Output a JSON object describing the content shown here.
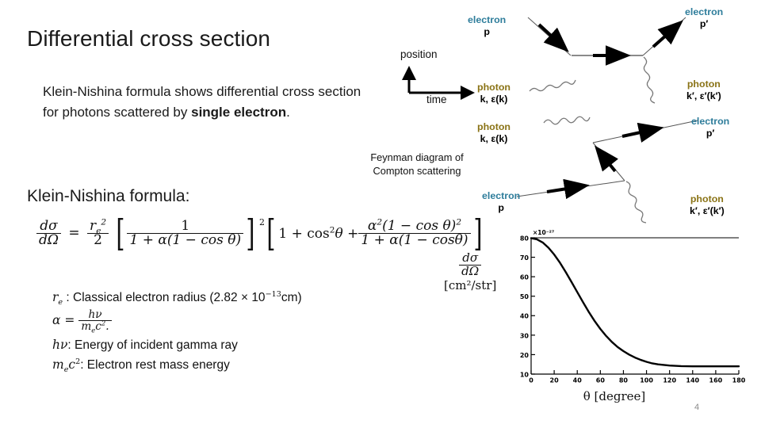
{
  "slide": {
    "title": "Differential cross section",
    "bullet_plain_1": "Klein-Nishina formula shows differential cross section for photons scattered by ",
    "bullet_bold": "single electron",
    "bullet_plain_2": ".",
    "formula_heading": "Klein-Nishina formula:",
    "page_number": "4"
  },
  "formula": {
    "lhs_num": "dσ",
    "lhs_den": "dΩ",
    "equals": "=",
    "coef_num": "r",
    "coef_num_sub": "e",
    "coef_num_sup": "2",
    "coef_den": "2",
    "bracket1_num": "1",
    "bracket1_den": "1 + α(1 − cos θ)",
    "bracket1_exp": "2",
    "bracket2_lead": "1 + cos",
    "bracket2_lead_sup": "2",
    "bracket2_theta": "θ +",
    "bracket2_num_a": "α",
    "bracket2_num_a_sup": "2",
    "bracket2_num_rest": "(1 − cos θ)",
    "bracket2_num_sup": "2",
    "bracket2_den": "1 + α(1 − cosθ)"
  },
  "definitions": {
    "re_sym": "r",
    "re_sub": "e",
    "re_text": " : Classical electron radius (2.82 × 10",
    "re_exp": "−13",
    "re_tail": "cm)",
    "alpha_sym": "α",
    "alpha_eq": "=",
    "alpha_num": "hν",
    "alpha_den": "m",
    "alpha_den_sub": "e",
    "alpha_den_c": "c",
    "alpha_den_sup": "2",
    "alpha_period": ".",
    "hv_sym": "hν",
    "hv_text": ": Energy of incident gamma ray",
    "mec_sym": "m",
    "mec_sub": "e",
    "mec_c": "c",
    "mec_sup": "2",
    "mec_text": ": Electron rest mass energy"
  },
  "unit_label": {
    "num": "dσ",
    "den": "dΩ",
    "bracket": "[cm²/str]"
  },
  "axes_legend": {
    "position": "position",
    "time": "time"
  },
  "feynman": {
    "caption_line1": "Feynman diagram of",
    "caption_line2": "Compton scattering",
    "electron_color": "#2E7D9B",
    "photon_color": "#8A7316",
    "labels": {
      "top_in_electron": "electron",
      "top_in_electron_p": "p",
      "top_out_electron": "electron",
      "top_out_electron_p": "p′",
      "top_in_photon": "photon",
      "top_in_photon_k": "k, ε(k)",
      "top_out_photon": "photon",
      "top_out_photon_k": "k′, ε′(k′)",
      "bot_in_photon": "photon",
      "bot_in_photon_k": "k, ε(k)",
      "bot_out_electron": "electron",
      "bot_out_electron_p": "p′",
      "bot_in_electron": "electron",
      "bot_in_electron_p": "p",
      "bot_out_photon": "photon",
      "bot_out_photon_k": "k′, ε′(k′)"
    }
  },
  "chart_data": {
    "type": "line",
    "title": "",
    "xlabel": "θ [degree]",
    "ylabel": "dσ/dΩ [cm²/str]",
    "y_exponent_label": "×10⁻²⁷",
    "xlim": [
      0,
      180
    ],
    "ylim": [
      10,
      80
    ],
    "xticks": [
      0,
      20,
      40,
      60,
      80,
      100,
      120,
      140,
      160,
      180
    ],
    "yticks": [
      10,
      20,
      30,
      40,
      50,
      60,
      70,
      80
    ],
    "grid": false,
    "legend": "none",
    "x": [
      0,
      5,
      10,
      15,
      20,
      25,
      30,
      35,
      40,
      45,
      50,
      55,
      60,
      65,
      70,
      75,
      80,
      85,
      90,
      95,
      100,
      105,
      110,
      120,
      130,
      140,
      150,
      160,
      170,
      180
    ],
    "y": [
      79.8,
      79.2,
      77.6,
      74.9,
      71.4,
      67.2,
      62.4,
      57.3,
      52.1,
      46.9,
      41.9,
      37.3,
      33.2,
      29.6,
      26.5,
      23.9,
      21.8,
      20.0,
      18.5,
      17.3,
      16.3,
      15.5,
      15.0,
      14.4,
      14.1,
      14.0,
      14.0,
      14.0,
      14.0,
      14.0
    ]
  }
}
